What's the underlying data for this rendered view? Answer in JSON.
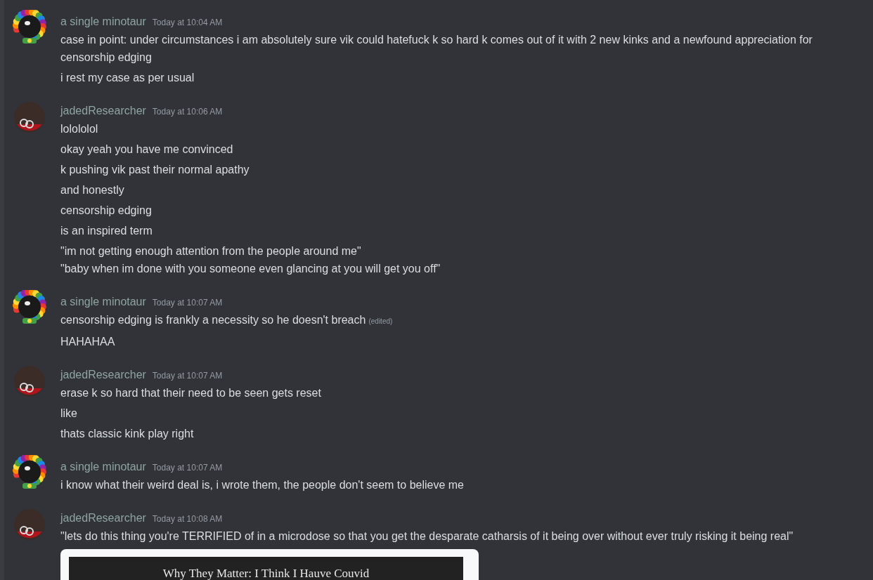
{
  "messages_groups": [
    {
      "author": "a single minotaur",
      "kind": "rainbow",
      "time": "Today at 10:04 AM",
      "messages": [
        {
          "text": "case in point: under circumstances i am absolutely sure vik could hatefuck k so hard k comes out of it with 2 new kinks and a newfound appreciation for censorship edging",
          "edited": false
        },
        {
          "text": "i rest my case as per usual",
          "edited": false
        }
      ]
    },
    {
      "author": "jadedResearcher",
      "kind": "dark",
      "time": "Today at 10:06 AM",
      "messages": [
        {
          "text": "lolololol",
          "edited": false
        },
        {
          "text": "okay yeah you have me convinced",
          "edited": false
        },
        {
          "text": "k pushing vik past their normal apathy",
          "edited": false
        },
        {
          "text": "and honestly",
          "edited": false
        },
        {
          "text": "censorship edging",
          "edited": false
        },
        {
          "text": "is an inspired term",
          "edited": false
        },
        {
          "text": "\"im not getting enough attention from the people around me\"\n\"baby when im done with you someone even glancing at you will get you off\"",
          "edited": false
        }
      ]
    },
    {
      "author": "a single minotaur",
      "kind": "rainbow",
      "time": "Today at 10:07 AM",
      "messages": [
        {
          "text": "censorship edging is frankly a necessity so he doesn't breach",
          "edited": true,
          "edited_label": "(edited)"
        },
        {
          "text": "HAHAHAA",
          "edited": false
        }
      ]
    },
    {
      "author": "jadedResearcher",
      "kind": "dark",
      "time": "Today at 10:07 AM",
      "messages": [
        {
          "text": "erase k so hard that their need to be seen gets reset",
          "edited": false
        },
        {
          "text": "like",
          "edited": false
        },
        {
          "text": "thats classic kink play right",
          "edited": false
        }
      ]
    },
    {
      "author": "a single minotaur",
      "kind": "rainbow",
      "time": "Today at 10:07 AM",
      "messages": [
        {
          "text": "i know what their weird deal is, i wrote them, the people don't seem to believe me",
          "edited": false
        }
      ]
    },
    {
      "author": "jadedResearcher",
      "kind": "dark",
      "time": "Today at 10:08 AM",
      "messages": [
        {
          "text": "\"lets do this thing you're TERRIFIED of in a microdose so that you get the desparate catharsis of it being over without ever truly risking it being real\"",
          "edited": false
        }
      ],
      "attachment": {
        "title": "Why They Matter: I Think I Hauve Couvid"
      }
    }
  ]
}
